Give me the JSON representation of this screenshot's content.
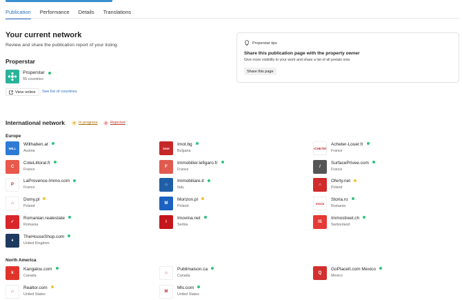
{
  "colors": {
    "accent": "#2a6fc2",
    "online": "#2ec27e",
    "in_progress": "#f2c230",
    "rejected": "#c0392b"
  },
  "tabs": [
    {
      "label": "Publication",
      "active": true
    },
    {
      "label": "Performance",
      "active": false
    },
    {
      "label": "Details",
      "active": false
    },
    {
      "label": "Translations",
      "active": false
    }
  ],
  "network": {
    "title": "Your current network",
    "subtitle": "Review and share the publication report of your listing."
  },
  "properstar": {
    "heading": "Properstar",
    "name": "Properstar",
    "countries": "55 countries",
    "view_online": "View online",
    "see_list": "See list of countries"
  },
  "tips": {
    "label": "Properstar tips",
    "title": "Share this publication page with the property owner",
    "text": "Give more visibility to your work and share a list of all portals now.",
    "button": "Share this page"
  },
  "international": {
    "title": "International network",
    "in_progress_count": "7",
    "in_progress_label": "In progress",
    "rejected_count": "2",
    "rejected_label": "Rejected"
  },
  "regions": {
    "europe": "Europe",
    "north_america": "North America"
  },
  "europe_portals": [
    {
      "name": "Willhaben.at",
      "country": "Austria",
      "status": "green",
      "logo_text": "WILL",
      "logo_color": "#2e7bd6"
    },
    {
      "name": "Imot.bg",
      "country": "Bulgaria",
      "status": "green",
      "logo_text": "imot",
      "logo_color": "#c62828"
    },
    {
      "name": "Acheter-Louer.fr",
      "country": "France",
      "status": "green",
      "logo_text": "ACHETER",
      "logo_color": "#ffffff"
    },
    {
      "name": "CoteLittoral.fr",
      "country": "France",
      "status": "green",
      "logo_text": "C",
      "logo_color": "#e8584b"
    },
    {
      "name": "Immobilier.lefigaro.fr",
      "country": "France",
      "status": "green",
      "logo_text": "F",
      "logo_color": "#e05a4e"
    },
    {
      "name": "SurfacePrivee.com",
      "country": "France",
      "status": "green",
      "logo_text": "/",
      "logo_color": "#555555"
    },
    {
      "name": "LaProvence-Immo.com",
      "country": "France",
      "status": "green",
      "logo_text": "P",
      "logo_color": "#ffffff"
    },
    {
      "name": "Immobiliare.it",
      "country": "Italy",
      "status": "green",
      "logo_text": "⌂",
      "logo_color": "#1f5fa8"
    },
    {
      "name": "Oferty.net",
      "country": "Poland",
      "status": "yellow",
      "logo_text": "⌂",
      "logo_color": "#d12a2a"
    },
    {
      "name": "Domy.pl",
      "country": "Poland",
      "status": "yellow",
      "logo_text": "⌂",
      "logo_color": "#ffffff"
    },
    {
      "name": "Morizon.pl",
      "country": "Poland",
      "status": "yellow",
      "logo_text": "M",
      "logo_color": "#1c62c0"
    },
    {
      "name": "Storia.ro",
      "country": "Romania",
      "status": "green",
      "logo_text": "storia",
      "logo_color": "#ffffff"
    },
    {
      "name": "Romanian.realestate",
      "country": "Romania",
      "status": "green",
      "logo_text": "✓",
      "logo_color": "#d9262b"
    },
    {
      "name": "Imovina.net",
      "country": "Serbia",
      "status": "green",
      "logo_text": "i",
      "logo_color": "#c4161c"
    },
    {
      "name": "Immostreet.ch",
      "country": "Switzerland",
      "status": "green",
      "logo_text": "IS",
      "logo_color": "#e53935"
    },
    {
      "name": "TheHouseShop.com",
      "country": "United Kingdom",
      "status": "green",
      "logo_text": "♦",
      "logo_color": "#1e3a5f"
    }
  ],
  "na_portals": [
    {
      "name": "Kangalou.com",
      "country": "Canada",
      "status": "green",
      "logo_text": "k",
      "logo_color": "#e0342b"
    },
    {
      "name": "Publimaison.ca",
      "country": "Canada",
      "status": "green",
      "logo_text": "⌂",
      "logo_color": "#ffffff"
    },
    {
      "name": "GoPlaceIt.com Mexico",
      "country": "Mexico",
      "status": "green",
      "logo_text": "Q",
      "logo_color": "#d32f2f"
    },
    {
      "name": "Realtor.com",
      "country": "United States",
      "status": "yellow",
      "logo_text": "⌂",
      "logo_color": "#ffffff"
    },
    {
      "name": "Mls.com",
      "country": "United States",
      "status": "green",
      "logo_text": "M",
      "logo_color": "#ffffff"
    }
  ]
}
